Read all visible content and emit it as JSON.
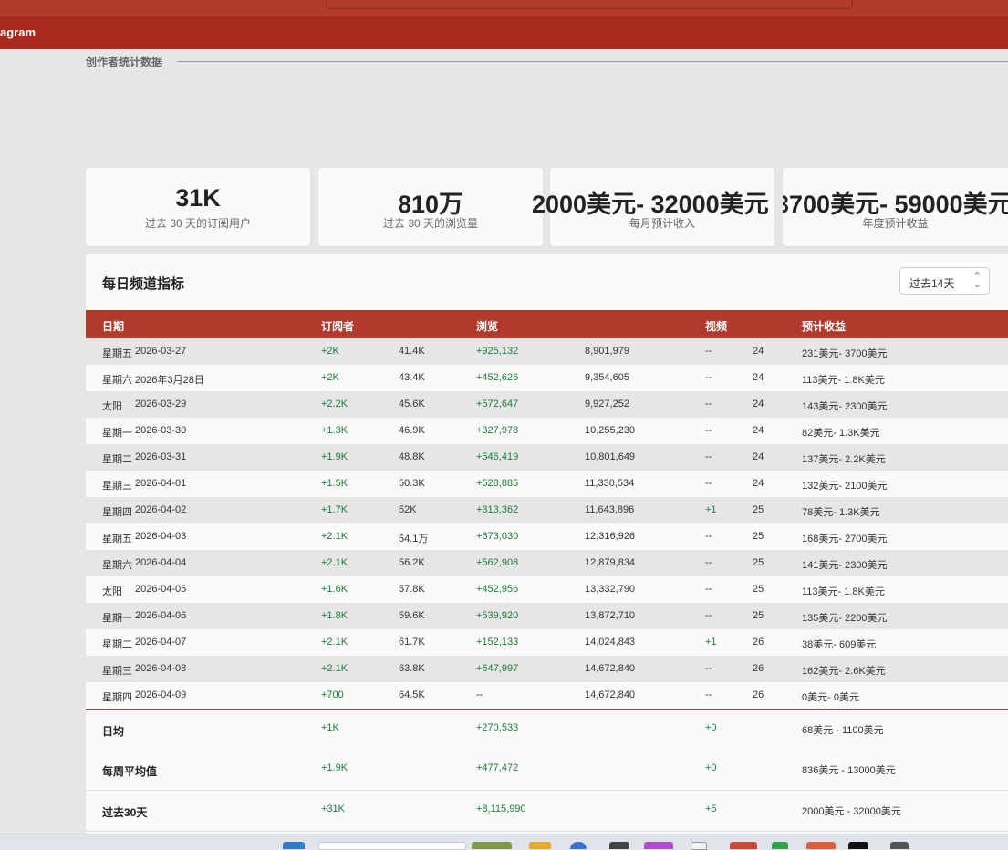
{
  "header": {
    "brand_text": "agram"
  },
  "section": {
    "title": "创作者统计数据"
  },
  "stats": [
    {
      "value": "31K",
      "label": "过去 30 天的订阅用户"
    },
    {
      "value": "810万",
      "label": "过去 30 天的浏览量"
    },
    {
      "value": "2000美元- 32000美元",
      "label": "每月预计收入"
    },
    {
      "value": "3700美元- 59000美元",
      "label": "年度预计收益"
    }
  ],
  "panel": {
    "title": "每日频道指标",
    "range_value": "过去14天",
    "range_icon": "chevron-updown-icon"
  },
  "table": {
    "headers": {
      "date": "日期",
      "subs": "订阅者",
      "views": "浏览",
      "videos": "视频",
      "earnings": "预计收益"
    },
    "rows": [
      {
        "day": "星期五",
        "date": "2026-03-27",
        "subs_delta": "+2K",
        "subs_total": "41.4K",
        "views_delta": "+925,132",
        "views_total": "8,901,979",
        "videos_delta": "--",
        "videos_total": "24",
        "earnings": "231美元- 3700美元"
      },
      {
        "day": "星期六",
        "date": "2026年3月28日",
        "subs_delta": "+2K",
        "subs_total": "43.4K",
        "views_delta": "+452,626",
        "views_total": "9,354,605",
        "videos_delta": "--",
        "videos_total": "24",
        "earnings": "113美元- 1.8K美元"
      },
      {
        "day": "太阳",
        "date": "2026-03-29",
        "subs_delta": "+2.2K",
        "subs_total": "45.6K",
        "views_delta": "+572,647",
        "views_total": "9,927,252",
        "videos_delta": "--",
        "videos_total": "24",
        "earnings": "143美元- 2300美元"
      },
      {
        "day": "星期一",
        "date": "2026-03-30",
        "subs_delta": "+1.3K",
        "subs_total": "46.9K",
        "views_delta": "+327,978",
        "views_total": "10,255,230",
        "videos_delta": "--",
        "videos_total": "24",
        "earnings": "82美元- 1.3K美元"
      },
      {
        "day": "星期二",
        "date": "2026-03-31",
        "subs_delta": "+1.9K",
        "subs_total": "48.8K",
        "views_delta": "+546,419",
        "views_total": "10,801,649",
        "videos_delta": "--",
        "videos_total": "24",
        "earnings": "137美元- 2.2K美元"
      },
      {
        "day": "星期三",
        "date": "2026-04-01",
        "subs_delta": "+1.5K",
        "subs_total": "50.3K",
        "views_delta": "+528,885",
        "views_total": "11,330,534",
        "videos_delta": "--",
        "videos_total": "24",
        "earnings": "132美元- 2100美元"
      },
      {
        "day": "星期四",
        "date": "2026-04-02",
        "subs_delta": "+1.7K",
        "subs_total": "52K",
        "views_delta": "+313,362",
        "views_total": "11,643,896",
        "videos_delta": "+1",
        "videos_total": "25",
        "earnings": "78美元- 1.3K美元"
      },
      {
        "day": "星期五",
        "date": "2026-04-03",
        "subs_delta": "+2.1K",
        "subs_total": "54.1万",
        "views_delta": "+673,030",
        "views_total": "12,316,926",
        "videos_delta": "--",
        "videos_total": "25",
        "earnings": "168美元- 2700美元"
      },
      {
        "day": "星期六",
        "date": "2026-04-04",
        "subs_delta": "+2.1K",
        "subs_total": "56.2K",
        "views_delta": "+562,908",
        "views_total": "12,879,834",
        "videos_delta": "--",
        "videos_total": "25",
        "earnings": "141美元- 2300美元"
      },
      {
        "day": "太阳",
        "date": "2026-04-05",
        "subs_delta": "+1.6K",
        "subs_total": "57.8K",
        "views_delta": "+452,956",
        "views_total": "13,332,790",
        "videos_delta": "--",
        "videos_total": "25",
        "earnings": "113美元- 1.8K美元"
      },
      {
        "day": "星期一",
        "date": "2026-04-06",
        "subs_delta": "+1.8K",
        "subs_total": "59.6K",
        "views_delta": "+539,920",
        "views_total": "13,872,710",
        "videos_delta": "--",
        "videos_total": "25",
        "earnings": "135美元- 2200美元"
      },
      {
        "day": "星期二",
        "date": "2026-04-07",
        "subs_delta": "+2.1K",
        "subs_total": "61.7K",
        "views_delta": "+152,133",
        "views_total": "14,024,843",
        "videos_delta": "+1",
        "videos_total": "26",
        "earnings": "38美元- 609美元"
      },
      {
        "day": "星期三",
        "date": "2026-04-08",
        "subs_delta": "+2.1K",
        "subs_total": "63.8K",
        "views_delta": "+647,997",
        "views_total": "14,672,840",
        "videos_delta": "--",
        "videos_total": "26",
        "earnings": "162美元- 2.6K美元"
      },
      {
        "day": "星期四",
        "date": "2026-04-09",
        "subs_delta": "+700",
        "subs_total": "64.5K",
        "views_delta": "--",
        "views_total": "14,672,840",
        "videos_delta": "--",
        "videos_total": "26",
        "earnings": "0美元- 0美元"
      }
    ],
    "summary": [
      {
        "label": "日均",
        "subs": "+1K",
        "views": "+270,533",
        "videos": "+0",
        "earnings": "68美元 - 1100美元"
      },
      {
        "label": "每周平均值",
        "subs": "+1.9K",
        "views": "+477,472",
        "videos": "+0",
        "earnings": "836美元 - 13000美元"
      },
      {
        "label": "过去30天",
        "subs": "+31K",
        "views": "+8,115,990",
        "videos": "+5",
        "earnings": "2000美元 - 32000美元"
      }
    ]
  },
  "colors": {
    "brand": "#b13a2d",
    "positive": "#1d7a3a"
  }
}
